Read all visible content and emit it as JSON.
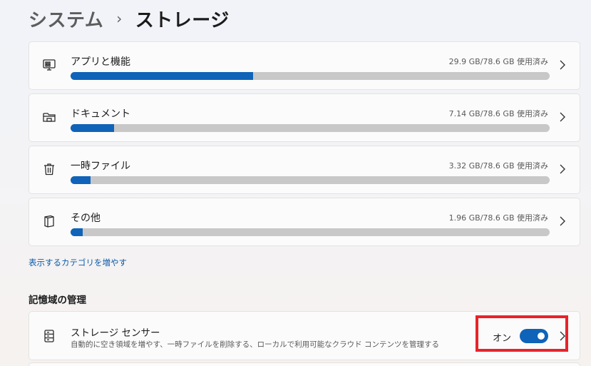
{
  "breadcrumb": {
    "parent": "システム",
    "separator": "›",
    "current": "ストレージ"
  },
  "storage_categories": [
    {
      "label": "アプリと機能",
      "usage": "29.9 GB/78.6 GB 使用済み",
      "used_fraction": 0.3804,
      "icon": "apps-monitor-icon"
    },
    {
      "label": "ドキュメント",
      "usage": "7.14 GB/78.6 GB 使用済み",
      "used_fraction": 0.0908,
      "icon": "folder-icon"
    },
    {
      "label": "一時ファイル",
      "usage": "3.32 GB/78.6 GB 使用済み",
      "used_fraction": 0.0422,
      "icon": "trash-icon"
    },
    {
      "label": "その他",
      "usage": "1.96 GB/78.6 GB 使用済み",
      "used_fraction": 0.0249,
      "icon": "document-icon"
    }
  ],
  "more_link": "表示するカテゴリを増やす",
  "management": {
    "section_title": "記憶域の管理",
    "storage_sense": {
      "title": "ストレージ センサー",
      "description": "自動的に空き領域を増やす、一時ファイルを削除する、ローカルで利用可能なクラウド コンテンツを管理する",
      "toggle_label": "オン",
      "toggle_on": true,
      "icon": "storage-drive-icon"
    }
  },
  "colors": {
    "accent": "#0f63b8",
    "bar_track": "#c8c8c8",
    "highlight": "#e8232a"
  }
}
